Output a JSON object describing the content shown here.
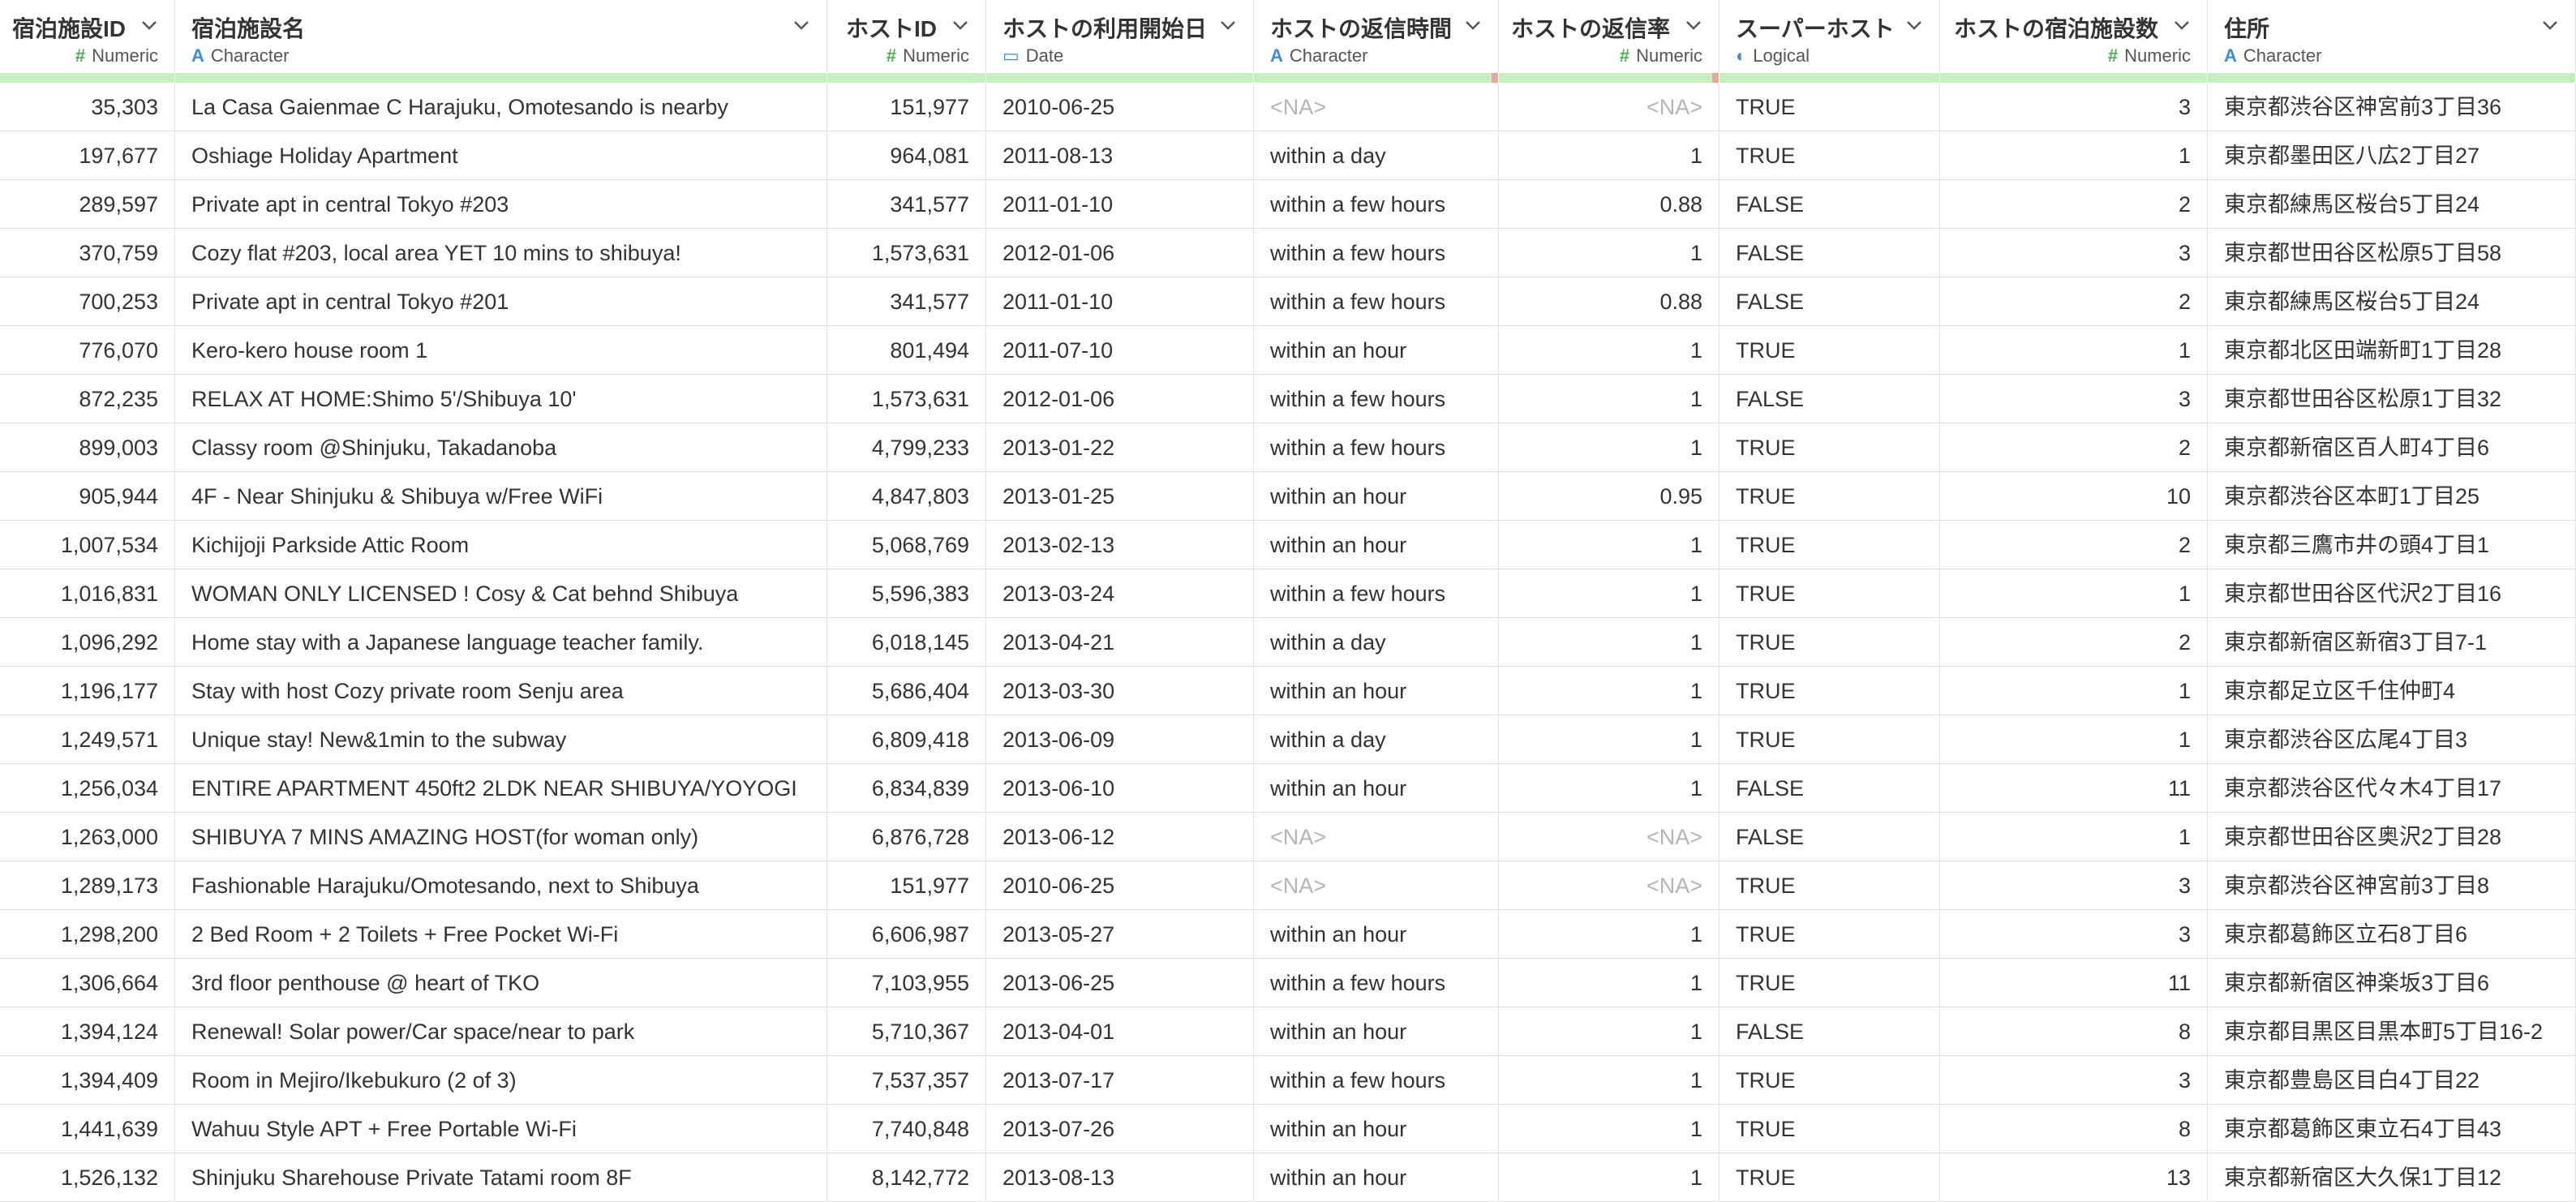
{
  "columns": [
    {
      "name": "宿泊施設ID",
      "type": "Numeric",
      "type_icon": "hash-icon",
      "align": "right"
    },
    {
      "name": "宿泊施設名",
      "type": "Character",
      "type_icon": "character-icon",
      "align": "left"
    },
    {
      "name": "ホストID",
      "type": "Numeric",
      "type_icon": "hash-icon",
      "align": "right"
    },
    {
      "name": "ホストの利用開始日",
      "type": "Date",
      "type_icon": "calendar-icon",
      "align": "left"
    },
    {
      "name": "ホストの返信時間",
      "type": "Character",
      "type_icon": "character-icon",
      "align": "left"
    },
    {
      "name": "ホストの返信率",
      "type": "Numeric",
      "type_icon": "hash-icon",
      "align": "right"
    },
    {
      "name": "スーパーホスト",
      "type": "Logical",
      "type_icon": "toggle-icon",
      "align": "left"
    },
    {
      "name": "ホストの宿泊施設数",
      "type": "Numeric",
      "type_icon": "hash-icon",
      "align": "right"
    },
    {
      "name": "住所",
      "type": "Character",
      "type_icon": "character-icon",
      "align": "left"
    }
  ],
  "missing_markers": [
    false,
    false,
    false,
    false,
    true,
    true,
    false,
    false,
    false
  ],
  "colors": {
    "quality_ok": "#c5efc0",
    "quality_missing": "#e5a3a3",
    "numeric_icon": "#4caf50",
    "type_icon": "#3a8ddb",
    "na_text": "#b4b4b4"
  },
  "rows": [
    [
      "35,303",
      "La Casa Gaienmae C Harajuku, Omotesando is nearby",
      "151,977",
      "2010-06-25",
      "<NA>",
      "<NA>",
      "TRUE",
      "3",
      "東京都渋谷区神宮前3丁目36"
    ],
    [
      "197,677",
      "Oshiage Holiday Apartment",
      "964,081",
      "2011-08-13",
      "within a day",
      "1",
      "TRUE",
      "1",
      "東京都墨田区八広2丁目27"
    ],
    [
      "289,597",
      "Private apt in central Tokyo #203",
      "341,577",
      "2011-01-10",
      "within a few hours",
      "0.88",
      "FALSE",
      "2",
      "東京都練馬区桜台5丁目24"
    ],
    [
      "370,759",
      "Cozy flat #203, local area YET 10 mins to shibuya!",
      "1,573,631",
      "2012-01-06",
      "within a few hours",
      "1",
      "FALSE",
      "3",
      "東京都世田谷区松原5丁目58"
    ],
    [
      "700,253",
      "Private apt in central Tokyo #201",
      "341,577",
      "2011-01-10",
      "within a few hours",
      "0.88",
      "FALSE",
      "2",
      "東京都練馬区桜台5丁目24"
    ],
    [
      "776,070",
      "Kero-kero house room 1",
      "801,494",
      "2011-07-10",
      "within an hour",
      "1",
      "TRUE",
      "1",
      "東京都北区田端新町1丁目28"
    ],
    [
      "872,235",
      "RELAX AT HOME:Shimo 5'/Shibuya 10'",
      "1,573,631",
      "2012-01-06",
      "within a few hours",
      "1",
      "FALSE",
      "3",
      "東京都世田谷区松原1丁目32"
    ],
    [
      "899,003",
      "Classy room @Shinjuku, Takadanoba",
      "4,799,233",
      "2013-01-22",
      "within a few hours",
      "1",
      "TRUE",
      "2",
      "東京都新宿区百人町4丁目6"
    ],
    [
      "905,944",
      "4F - Near Shinjuku & Shibuya w/Free WiFi",
      "4,847,803",
      "2013-01-25",
      "within an hour",
      "0.95",
      "TRUE",
      "10",
      "東京都渋谷区本町1丁目25"
    ],
    [
      "1,007,534",
      "Kichijoji Parkside Attic Room",
      "5,068,769",
      "2013-02-13",
      "within an hour",
      "1",
      "TRUE",
      "2",
      "東京都三鷹市井の頭4丁目1"
    ],
    [
      "1,016,831",
      "WOMAN ONLY LICENSED ! Cosy & Cat behnd Shibuya",
      "5,596,383",
      "2013-03-24",
      "within a few hours",
      "1",
      "TRUE",
      "1",
      "東京都世田谷区代沢2丁目16"
    ],
    [
      "1,096,292",
      "Home stay with a Japanese language teacher family.",
      "6,018,145",
      "2013-04-21",
      "within a day",
      "1",
      "TRUE",
      "2",
      "東京都新宿区新宿3丁目7-1"
    ],
    [
      "1,196,177",
      "Stay with host Cozy private room Senju area",
      "5,686,404",
      "2013-03-30",
      "within an hour",
      "1",
      "TRUE",
      "1",
      "東京都足立区千住仲町4"
    ],
    [
      "1,249,571",
      "Unique stay! New&1min to the subway",
      "6,809,418",
      "2013-06-09",
      "within a day",
      "1",
      "TRUE",
      "1",
      "東京都渋谷区広尾4丁目3"
    ],
    [
      "1,256,034",
      "ENTIRE APARTMENT 450ft2 2LDK NEAR SHIBUYA/YOYOGI",
      "6,834,839",
      "2013-06-10",
      "within an hour",
      "1",
      "FALSE",
      "11",
      "東京都渋谷区代々木4丁目17"
    ],
    [
      "1,263,000",
      "SHIBUYA 7 MINS AMAZING HOST(for woman only)",
      "6,876,728",
      "2013-06-12",
      "<NA>",
      "<NA>",
      "FALSE",
      "1",
      "東京都世田谷区奥沢2丁目28"
    ],
    [
      "1,289,173",
      "Fashionable Harajuku/Omotesando, next to Shibuya",
      "151,977",
      "2010-06-25",
      "<NA>",
      "<NA>",
      "TRUE",
      "3",
      "東京都渋谷区神宮前3丁目8"
    ],
    [
      "1,298,200",
      "2 Bed Room + 2 Toilets + Free Pocket Wi-Fi",
      "6,606,987",
      "2013-05-27",
      "within an hour",
      "1",
      "TRUE",
      "3",
      "東京都葛飾区立石8丁目6"
    ],
    [
      "1,306,664",
      "3rd floor penthouse @ heart of TKO",
      "7,103,955",
      "2013-06-25",
      "within a few hours",
      "1",
      "TRUE",
      "11",
      "東京都新宿区神楽坂3丁目6"
    ],
    [
      "1,394,124",
      "Renewal! Solar power/Car space/near to park",
      "5,710,367",
      "2013-04-01",
      "within an hour",
      "1",
      "FALSE",
      "8",
      "東京都目黒区目黒本町5丁目16-2"
    ],
    [
      "1,394,409",
      "Room in Mejiro/Ikebukuro (2 of 3)",
      "7,537,357",
      "2013-07-17",
      "within a few hours",
      "1",
      "TRUE",
      "3",
      "東京都豊島区目白4丁目22"
    ],
    [
      "1,441,639",
      "Wahuu Style APT + Free Portable Wi-Fi",
      "7,740,848",
      "2013-07-26",
      "within an hour",
      "1",
      "TRUE",
      "8",
      "東京都葛飾区東立石4丁目43"
    ],
    [
      "1,526,132",
      "Shinjuku Sharehouse Private Tatami room 8F",
      "8,142,772",
      "2013-08-13",
      "within an hour",
      "1",
      "TRUE",
      "13",
      "東京都新宿区大久保1丁目12"
    ]
  ]
}
